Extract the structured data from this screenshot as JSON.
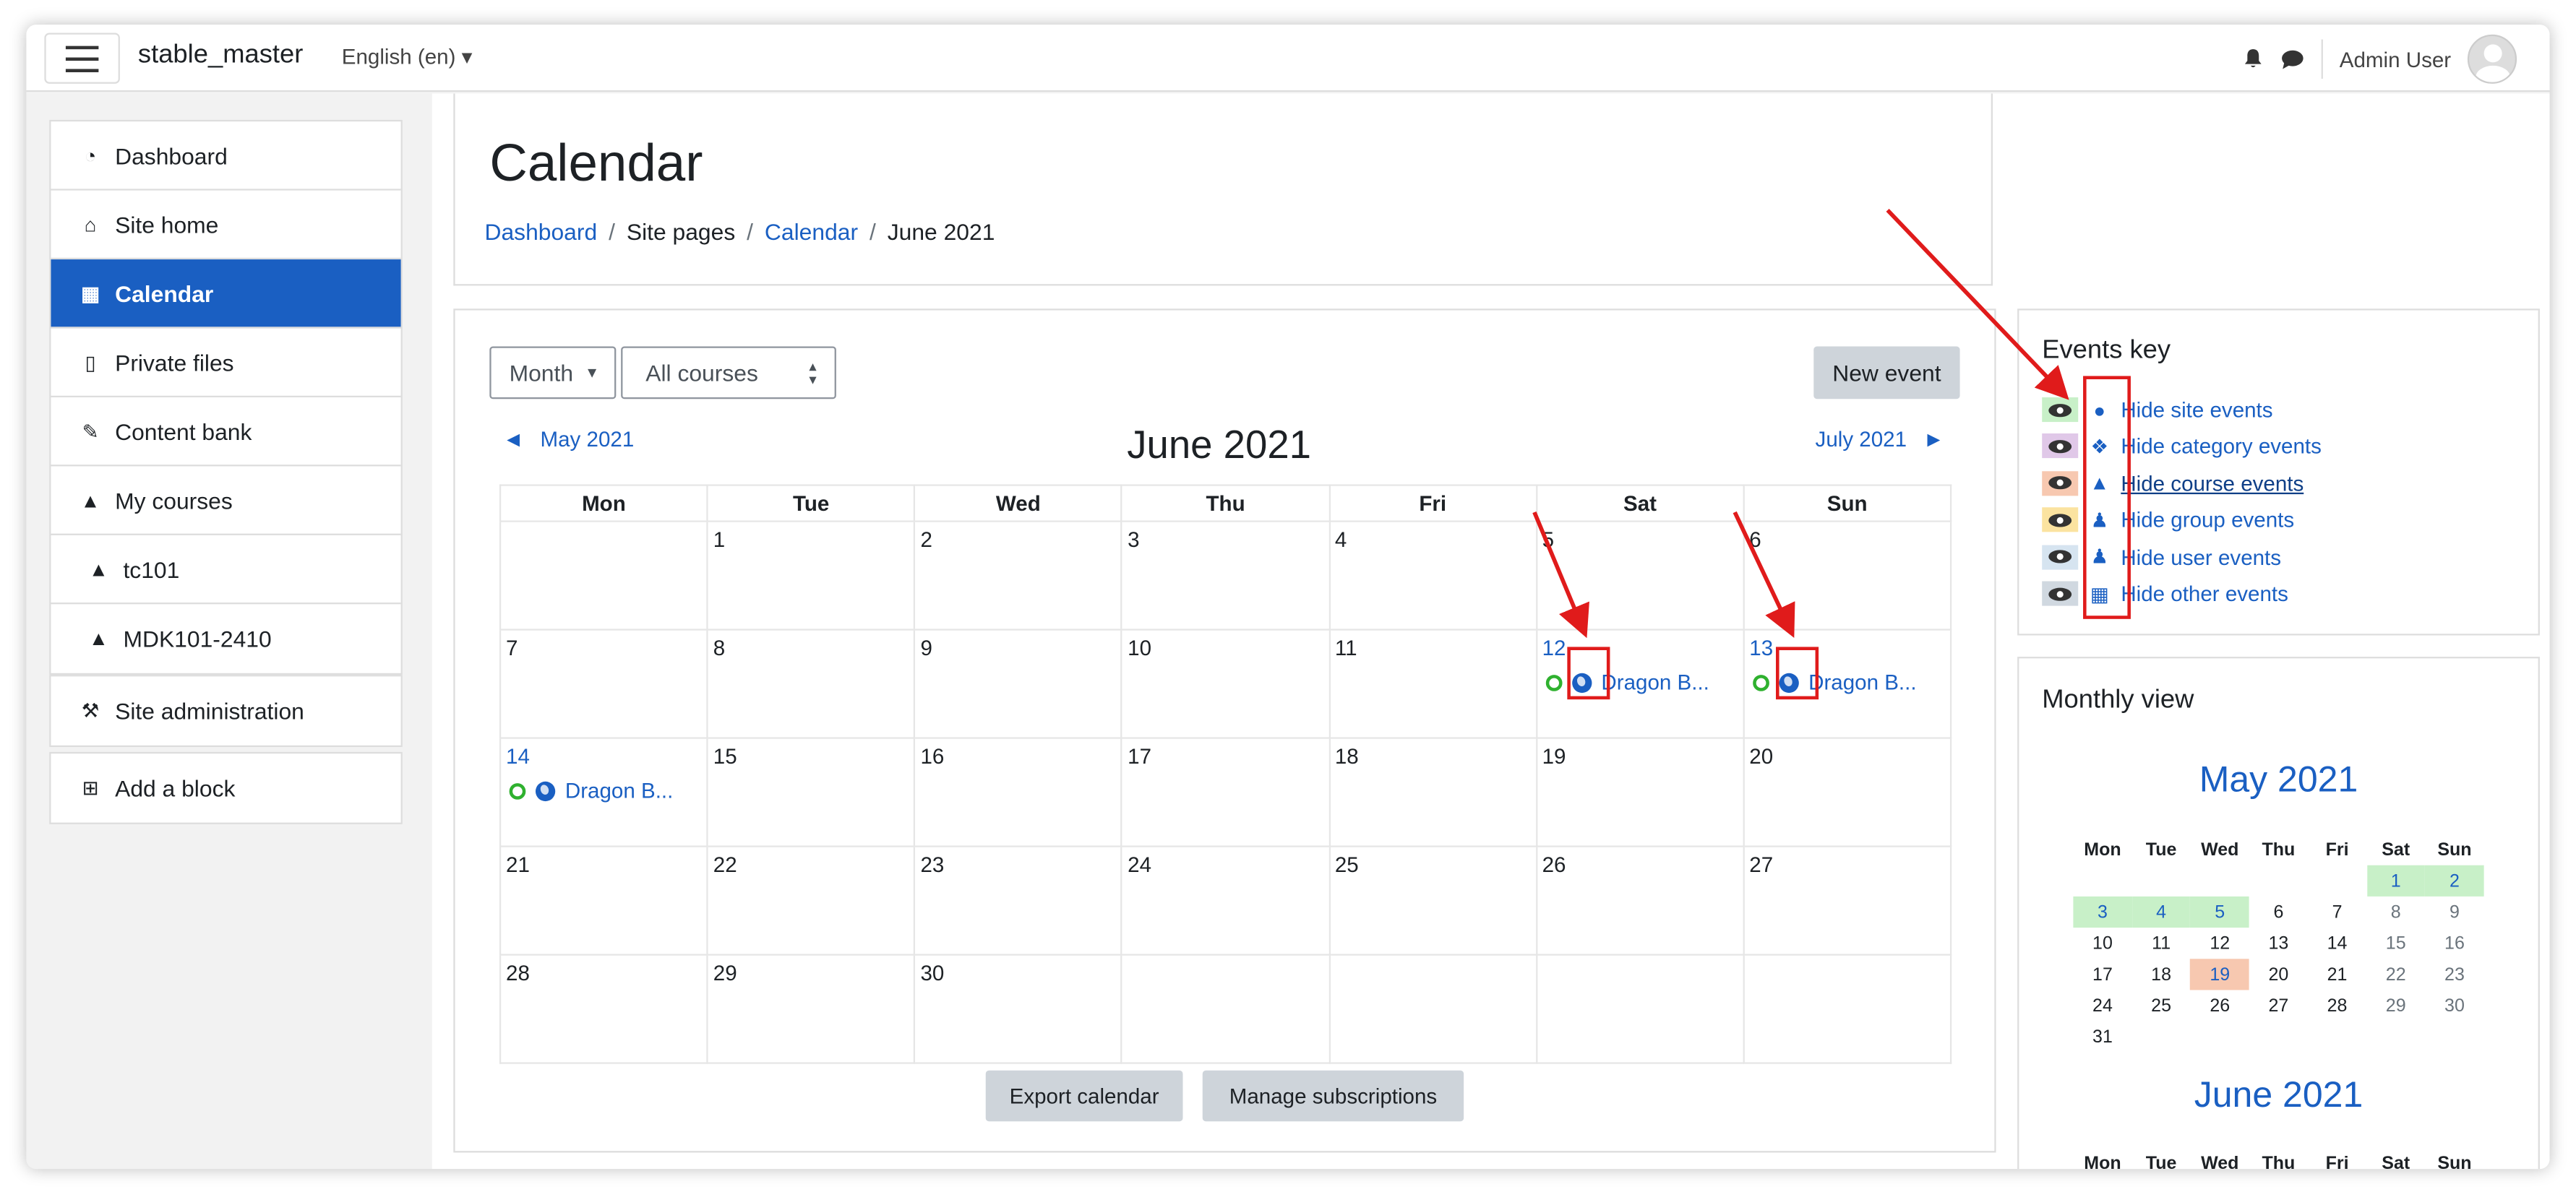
{
  "navbar": {
    "brand": "stable_master",
    "language": "English (en) ▾",
    "user": "Admin User"
  },
  "sidebar": {
    "items": [
      {
        "label": "Dashboard",
        "icon": "dashboard-icon"
      },
      {
        "label": "Site home",
        "icon": "home-icon"
      },
      {
        "label": "Calendar",
        "icon": "calendar-icon",
        "active": true
      },
      {
        "label": "Private files",
        "icon": "file-icon"
      },
      {
        "label": "Content bank",
        "icon": "brush-icon"
      },
      {
        "label": "My courses",
        "icon": "graduation-cap-icon"
      },
      {
        "label": "tc101",
        "icon": "graduation-cap-icon"
      },
      {
        "label": "MDK101-2410",
        "icon": "graduation-cap-icon"
      }
    ],
    "site_admin": "Site administration",
    "add_block": "Add a block"
  },
  "page": {
    "title": "Calendar",
    "breadcrumb": [
      "Dashboard",
      "Site pages",
      "Calendar",
      "June 2021"
    ]
  },
  "calendar": {
    "view_select": "Month",
    "course_select": "All courses",
    "new_event": "New event",
    "prev_month": "May 2021",
    "next_month": "July 2021",
    "current_month": "June 2021",
    "weekdays": [
      "Mon",
      "Tue",
      "Wed",
      "Thu",
      "Fri",
      "Sat",
      "Sun"
    ],
    "weeks": [
      [
        "",
        "1",
        "2",
        "3",
        "4",
        "5",
        "6"
      ],
      [
        "7",
        "8",
        "9",
        "10",
        "11",
        "12",
        "13"
      ],
      [
        "14",
        "15",
        "16",
        "17",
        "18",
        "19",
        "20"
      ],
      [
        "21",
        "22",
        "23",
        "24",
        "25",
        "26",
        "27"
      ],
      [
        "28",
        "29",
        "30",
        "",
        "",
        "",
        ""
      ]
    ],
    "event_label": "Dragon B...",
    "event_days": [
      "12",
      "13",
      "14"
    ],
    "export": "Export calendar",
    "manage": "Manage subscriptions"
  },
  "events_key": {
    "title": "Events key",
    "rows": [
      {
        "label": "Hide site events",
        "color": "#c8f0c8",
        "icon": "globe-icon"
      },
      {
        "label": "Hide category events",
        "color": "#e0c8e8",
        "icon": "cubes-icon"
      },
      {
        "label": "Hide course events",
        "color": "#f7c8b0",
        "icon": "graduation-cap-icon"
      },
      {
        "label": "Hide group events",
        "color": "#fbe3a0",
        "icon": "users-icon"
      },
      {
        "label": "Hide user events",
        "color": "#d6e4f0",
        "icon": "user-icon"
      },
      {
        "label": "Hide other events",
        "color": "#d0d8e0",
        "icon": "calendar-icon"
      }
    ]
  },
  "monthly": {
    "title": "Monthly view",
    "may_title": "May 2021",
    "june_title": "June 2021",
    "weekdays": [
      "Mon",
      "Tue",
      "Wed",
      "Thu",
      "Fri",
      "Sat",
      "Sun"
    ],
    "may_weeks": [
      [
        "",
        "",
        "",
        "",
        "",
        "1",
        "2"
      ],
      [
        "3",
        "4",
        "5",
        "6",
        "7",
        "8",
        "9"
      ],
      [
        "10",
        "11",
        "12",
        "13",
        "14",
        "15",
        "16"
      ],
      [
        "17",
        "18",
        "19",
        "20",
        "21",
        "22",
        "23"
      ],
      [
        "24",
        "25",
        "26",
        "27",
        "28",
        "29",
        "30"
      ],
      [
        "31",
        "",
        "",
        "",
        "",
        "",
        ""
      ]
    ],
    "highlight_green": [
      "1",
      "2",
      "3",
      "4",
      "5"
    ],
    "highlight_orange": [
      "19"
    ]
  },
  "colors": {
    "primary": "#1a5fc2",
    "annotation": "#e01b1b"
  }
}
